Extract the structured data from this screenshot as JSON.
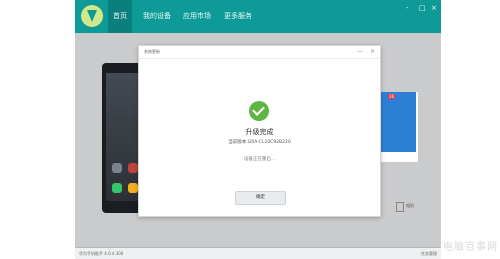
{
  "app": {
    "nav_tabs": [
      {
        "label": "首页"
      },
      {
        "label": "我的设备"
      },
      {
        "label": "应用市场"
      },
      {
        "label": "更多服务"
      }
    ],
    "window_controls": [
      "-",
      "□",
      "×"
    ],
    "status_left": "华为手机助手 4.0.4.300",
    "status_right": "任务管理"
  },
  "dialog": {
    "title": "系统更新",
    "controls": [
      "—",
      "×"
    ],
    "heading": "升级完成",
    "version_line": "当前版本:GRA-CL10C92B220",
    "status_line": "设备正在重启...",
    "ok_label": "确定"
  },
  "background": {
    "notice_badge": "26",
    "right_side_label": "相机"
  },
  "watermark": "电脑百事网",
  "colors": {
    "topbar": "#0e9a97",
    "success": "#5fb541"
  }
}
